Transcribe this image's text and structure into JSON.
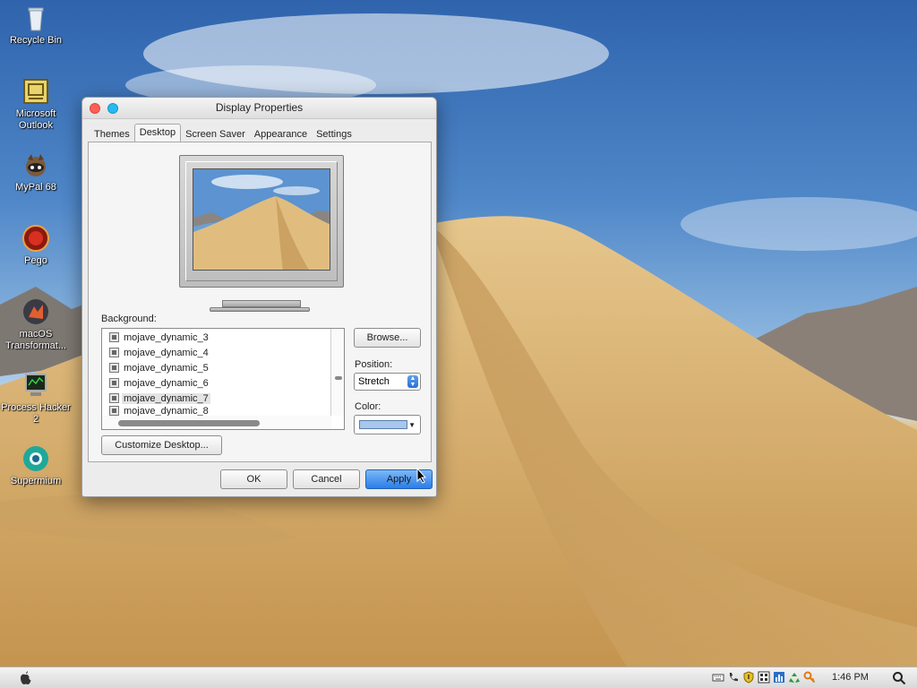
{
  "desktop_icons": [
    {
      "label": "Recycle Bin",
      "icon": "recycle-bin-icon"
    },
    {
      "label": "Microsoft Outlook",
      "icon": "outlook-icon"
    },
    {
      "label": "MyPal 68",
      "icon": "mypal-icon"
    },
    {
      "label": "Pego",
      "icon": "pego-icon"
    },
    {
      "label": "macOS Transformat...",
      "icon": "macos-transformation-icon"
    },
    {
      "label": "Process Hacker 2",
      "icon": "process-hacker-icon"
    },
    {
      "label": "Supermium",
      "icon": "supermium-icon"
    }
  ],
  "window": {
    "title": "Display Properties",
    "tabs": [
      {
        "label": "Themes"
      },
      {
        "label": "Desktop"
      },
      {
        "label": "Screen Saver"
      },
      {
        "label": "Appearance"
      },
      {
        "label": "Settings"
      }
    ],
    "active_tab": "Desktop",
    "background_label": "Background:",
    "background_items": [
      {
        "label": "mojave_dynamic_3"
      },
      {
        "label": "mojave_dynamic_4"
      },
      {
        "label": "mojave_dynamic_5"
      },
      {
        "label": "mojave_dynamic_6"
      },
      {
        "label": "mojave_dynamic_7"
      },
      {
        "label": "mojave_dynamic_8"
      }
    ],
    "selected_background": "mojave_dynamic_7",
    "browse_label": "Browse...",
    "position_label": "Position:",
    "position_value": "Stretch",
    "color_label": "Color:",
    "color_value": "#a7c7ec",
    "customize_label": "Customize Desktop...",
    "ok_label": "OK",
    "cancel_label": "Cancel",
    "apply_label": "Apply"
  },
  "taskbar": {
    "clock": "1:46 PM",
    "start_icon": "apple-icon",
    "tray_icons": [
      "keyboard-icon",
      "phone-icon",
      "shield-icon",
      "network-icon",
      "chart-icon",
      "recycle-icon",
      "key-icon"
    ],
    "search_icon": "search-icon"
  },
  "colors": {
    "accent": "#2a7de8",
    "close": "#fc5f57",
    "zoom": "#27b9f3"
  }
}
